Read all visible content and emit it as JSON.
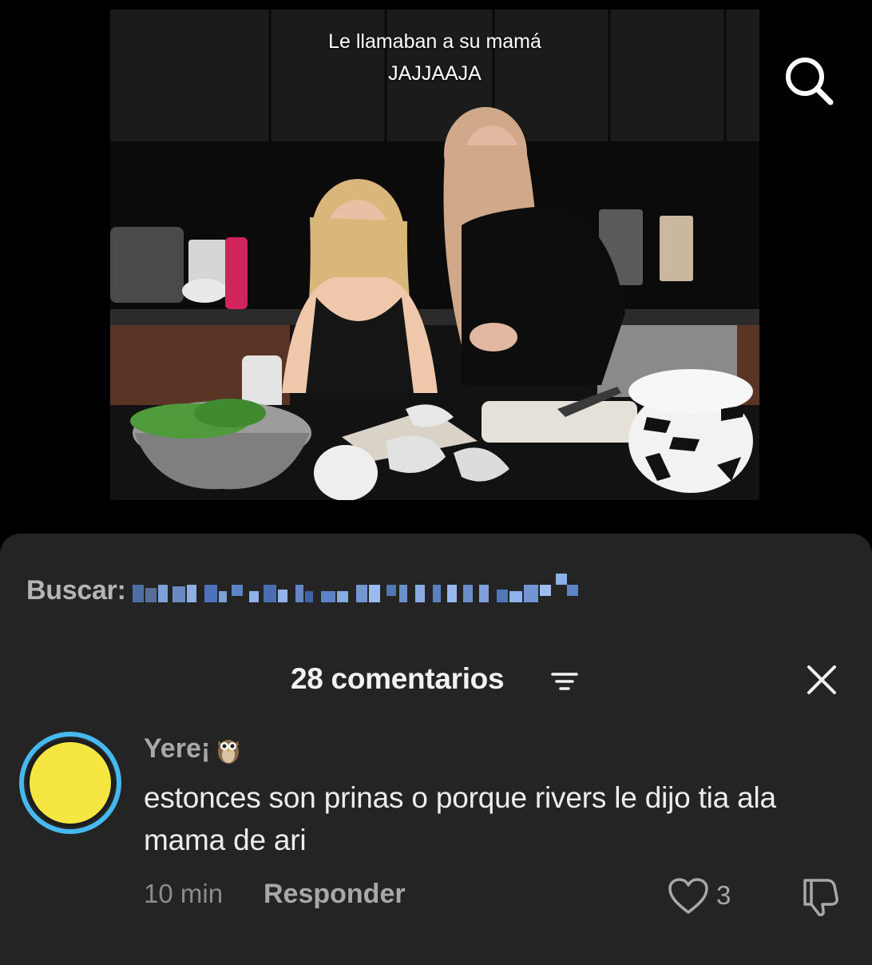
{
  "video": {
    "caption_line1": "Le llamaban a su mamá",
    "caption_line2": "JAJJAAJA",
    "search_icon": "search-icon"
  },
  "comments_sheet": {
    "search_label": "Buscar:",
    "count_label": "28 comentarios",
    "filter_icon": "filter-icon",
    "close_icon": "close-icon"
  },
  "comment": {
    "avatar_color": "#f5e642",
    "avatar_ring": "#46b9ee",
    "username": "Yere¡",
    "username_emoji": "owl-icon",
    "text": "estonces son prinas o porque rivers le dijo tia ala mama de ari",
    "time": "10 min",
    "reply_label": "Responder",
    "likes": "3"
  },
  "colors": {
    "sheet_bg": "#242424",
    "page_bg": "#000000"
  }
}
